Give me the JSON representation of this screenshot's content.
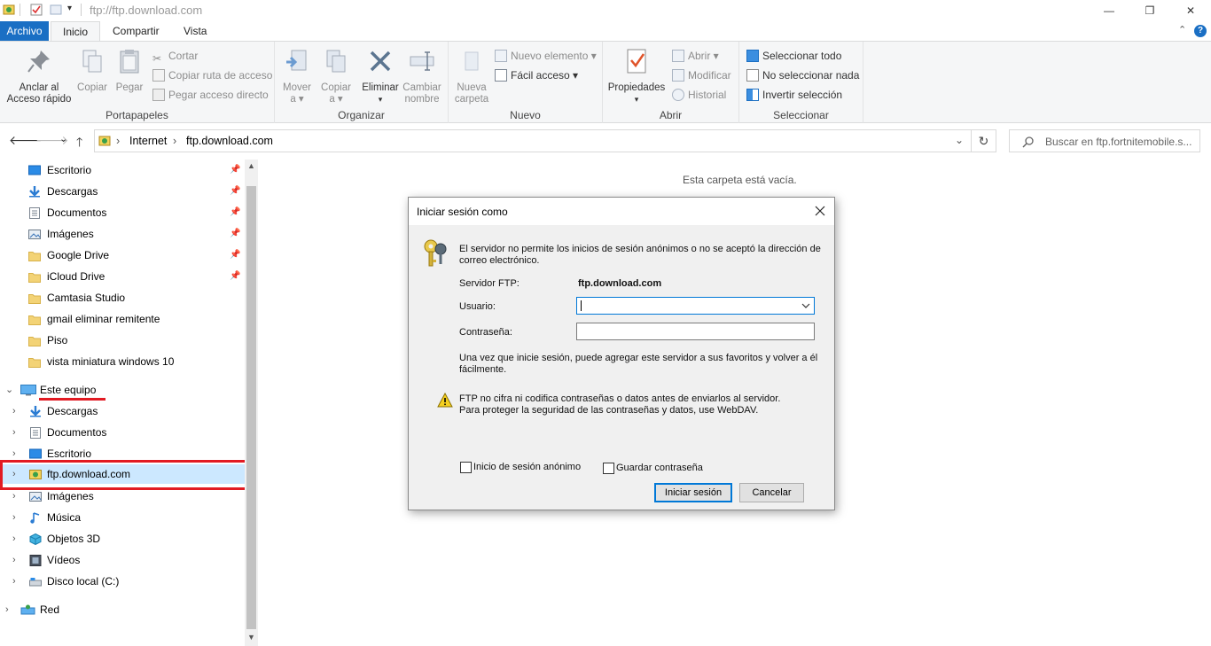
{
  "window": {
    "title": "ftp://ftp.download.com",
    "minimize_glyph": "—",
    "restore_glyph": "❐",
    "close_glyph": "✕"
  },
  "tabs": [
    {
      "label": "Archivo"
    },
    {
      "label": "Inicio"
    },
    {
      "label": "Compartir"
    },
    {
      "label": "Vista"
    }
  ],
  "ribbon": {
    "portapapeles": {
      "label": "Portapapeles",
      "anclar_line1": "Anclar al",
      "anclar_line2": "Acceso rápido",
      "copiar": "Copiar",
      "pegar": "Pegar",
      "cortar": "Cortar",
      "copiar_ruta": "Copiar ruta de acceso",
      "pegar_acceso": "Pegar acceso directo"
    },
    "organizar": {
      "label": "Organizar",
      "mover_line1": "Mover",
      "mover_line2": "a ▾",
      "copiar_line1": "Copiar",
      "copiar_line2": "a ▾",
      "eliminar_line1": "Eliminar",
      "eliminar_line2": "▾",
      "cambiar_line1": "Cambiar",
      "cambiar_line2": "nombre"
    },
    "nuevo": {
      "label": "Nuevo",
      "nueva_line1": "Nueva",
      "nueva_line2": "carpeta",
      "nuevo_elemento": "Nuevo elemento ▾",
      "facil_acceso": "Fácil acceso ▾"
    },
    "abrir": {
      "label": "Abrir",
      "propiedades_line1": "Propiedades",
      "propiedades_line2": "▾",
      "abrir": "Abrir ▾",
      "modificar": "Modificar",
      "historial": "Historial"
    },
    "seleccionar": {
      "label": "Seleccionar",
      "todo": "Seleccionar todo",
      "nada": "No seleccionar nada",
      "invertir": "Invertir selección"
    }
  },
  "address": {
    "back": "🡐",
    "forward": "🡒",
    "recent": "⌄",
    "up": "🡑",
    "crumbs": [
      "Internet",
      "ftp.download.com"
    ],
    "separator": "›",
    "dropdown": "⌄",
    "refresh": "↻",
    "search_placeholder": "Buscar en ftp.fortnitemobile.s..."
  },
  "nav": {
    "quick_access": [
      {
        "label": "Escritorio",
        "icon": "desktop-icon",
        "pinned": true
      },
      {
        "label": "Descargas",
        "icon": "download-icon",
        "pinned": true
      },
      {
        "label": "Documentos",
        "icon": "document-icon",
        "pinned": true
      },
      {
        "label": "Imágenes",
        "icon": "pictures-icon",
        "pinned": true
      },
      {
        "label": "Google Drive",
        "icon": "folder-icon",
        "pinned": true
      },
      {
        "label": "iCloud Drive",
        "icon": "folder-icon",
        "pinned": true
      },
      {
        "label": "Camtasia Studio",
        "icon": "folder-icon",
        "pinned": false
      },
      {
        "label": "gmail eliminar remitente",
        "icon": "folder-icon",
        "pinned": false
      },
      {
        "label": "Piso",
        "icon": "folder-icon",
        "pinned": false
      },
      {
        "label": "vista miniatura windows 10",
        "icon": "folder-icon",
        "pinned": false
      }
    ],
    "this_pc": "Este equipo",
    "this_pc_children": [
      {
        "label": "Descargas",
        "icon": "download-icon"
      },
      {
        "label": "Documentos",
        "icon": "document-icon"
      },
      {
        "label": "Escritorio",
        "icon": "desktop-icon"
      },
      {
        "label": "ftp.download.com",
        "icon": "ftp-icon"
      },
      {
        "label": "Imágenes",
        "icon": "pictures-icon"
      },
      {
        "label": "Música",
        "icon": "music-icon"
      },
      {
        "label": "Objetos 3D",
        "icon": "objects3d-icon"
      },
      {
        "label": "Vídeos",
        "icon": "video-icon"
      },
      {
        "label": "Disco local (C:)",
        "icon": "drive-icon"
      }
    ],
    "network": "Red",
    "pin_glyph": "📌",
    "expand_glyph": "›",
    "collapse_glyph": "⌄"
  },
  "content": {
    "empty_text": "Esta carpeta está vacía."
  },
  "dialog": {
    "title": "Iniciar sesión como",
    "message_line1": "El servidor no permite los inicios de sesión anónimos o no se aceptó la dirección de",
    "message_line2": "correo electrónico.",
    "server_label": "Servidor FTP:",
    "server_value": "ftp.download.com",
    "user_label": "Usuario:",
    "user_value": "",
    "password_label": "Contraseña:",
    "password_value": "",
    "info_line1": "Una vez que inicie sesión, puede agregar este servidor a sus favoritos y volver a él",
    "info_line2": "fácilmente.",
    "warning_line1": "FTP no cifra ni codifica contraseñas o datos antes de enviarlos al servidor.",
    "warning_line2": "Para proteger la seguridad de las contraseñas y datos, use WebDAV.",
    "anon_label": "Inicio de sesión anónimo",
    "save_password_label": "Guardar contraseña",
    "login_button": "Iniciar sesión",
    "cancel_button": "Cancelar"
  },
  "colors": {
    "accent": "#1a6fc4",
    "highlight_box": "#e21b23",
    "selection": "#cce8ff"
  }
}
